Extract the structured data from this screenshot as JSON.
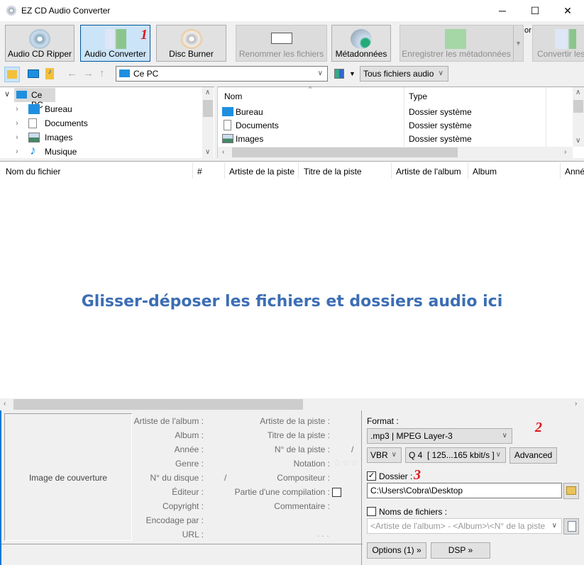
{
  "window": {
    "title": "EZ CD Audio Converter",
    "minimize": "─",
    "maximize": "☐",
    "close": "✕"
  },
  "toolbar": {
    "buttons": [
      {
        "label": "Audio CD Ripper"
      },
      {
        "label": "Audio Converter",
        "badge": "1"
      },
      {
        "label": "Disc Burner"
      },
      {
        "label": "Renommer les fichiers"
      },
      {
        "label": "Métadonnées"
      },
      {
        "label": "Enregistrer les métadonnées"
      },
      {
        "label": "Convertir les"
      }
    ],
    "or_text": "or"
  },
  "navbar": {
    "address": "Ce PC",
    "filter": "Tous fichiers audio"
  },
  "tree": {
    "root": "Ce PC",
    "items": [
      "Bureau",
      "Documents",
      "Images",
      "Musique"
    ]
  },
  "browser": {
    "columns": [
      "Nom",
      "Type"
    ],
    "rows": [
      {
        "name": "Bureau",
        "type": "Dossier système"
      },
      {
        "name": "Documents",
        "type": "Dossier système"
      },
      {
        "name": "Images",
        "type": "Dossier système"
      }
    ]
  },
  "filelist": {
    "columns": [
      "Nom du fichier",
      "#",
      "Artiste de la piste",
      "Titre de la piste",
      "Artiste de l'album",
      "Album",
      "Année"
    ],
    "drop_hint": "Glisser-déposer les fichiers et dossiers audio ici"
  },
  "metadata": {
    "cover": "Image de couverture",
    "left_labels": [
      "Artiste de l'album :",
      "Album :",
      "Année :",
      "Genre :",
      "N° du disque :",
      "Éditeur :",
      "Copyright :",
      "Encodage par :",
      "URL :"
    ],
    "right_labels": [
      "Artiste de la piste :",
      "Titre de la piste :",
      "N° de la piste :",
      "Notation :",
      "Compositeur :",
      "Partie d'une compilation :",
      "Commentaire :"
    ],
    "disc_sep": "/",
    "track_sep": "/",
    "url_more": ". . .",
    "rating": 0
  },
  "output": {
    "format_label": "Format :",
    "format": ".mp3 | MPEG Layer-3",
    "badge2": "2",
    "mode": "VBR",
    "quality": "Q 4  [ 125...165 kbit/s ]",
    "advanced": "Advanced",
    "folder_label": "Dossier :",
    "folder_checked": true,
    "badge3": "3",
    "folder": "C:\\Users\\Cobra\\Desktop",
    "filenames_label": "Noms de fichiers :",
    "filenames_checked": false,
    "filenames_pattern": "<Artiste de l'album> - <Album>\\<N° de la piste",
    "options": "Options (1) »",
    "dsp": "DSP »"
  },
  "colors": {
    "accent": "#0078d7",
    "hint": "#3c6eb4",
    "badge": "#e0161b"
  }
}
